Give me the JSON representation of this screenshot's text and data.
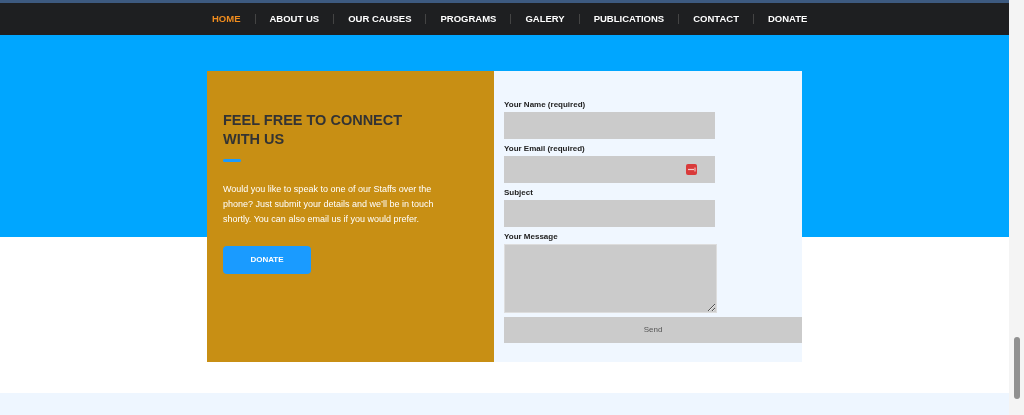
{
  "nav": {
    "items": [
      {
        "label": "HOME",
        "selected": true
      },
      {
        "label": "ABOUT US",
        "selected": false
      },
      {
        "label": "OUR CAUSES",
        "selected": false
      },
      {
        "label": "PROGRAMS",
        "selected": false
      },
      {
        "label": "GALERY",
        "selected": false
      },
      {
        "label": "PUBLICATIONS",
        "selected": false
      },
      {
        "label": "CONTACT",
        "selected": false
      },
      {
        "label": "DONATE",
        "selected": false
      }
    ]
  },
  "intro": {
    "title": "FEEL FREE TO CONNECT WITH US",
    "text": "Would you like to speak to one of our Staffs over the phone? Just submit your details and we’ll be in touch shortly. You can also email us if you would prefer.",
    "button": "DONATE"
  },
  "form": {
    "fields": [
      {
        "label": "Your Name (required)",
        "kind": "text"
      },
      {
        "label": "Your Email (required)",
        "kind": "email"
      },
      {
        "label": "Subject",
        "kind": "text"
      },
      {
        "label": "Your Message",
        "kind": "textarea"
      }
    ],
    "submit": "Send"
  }
}
